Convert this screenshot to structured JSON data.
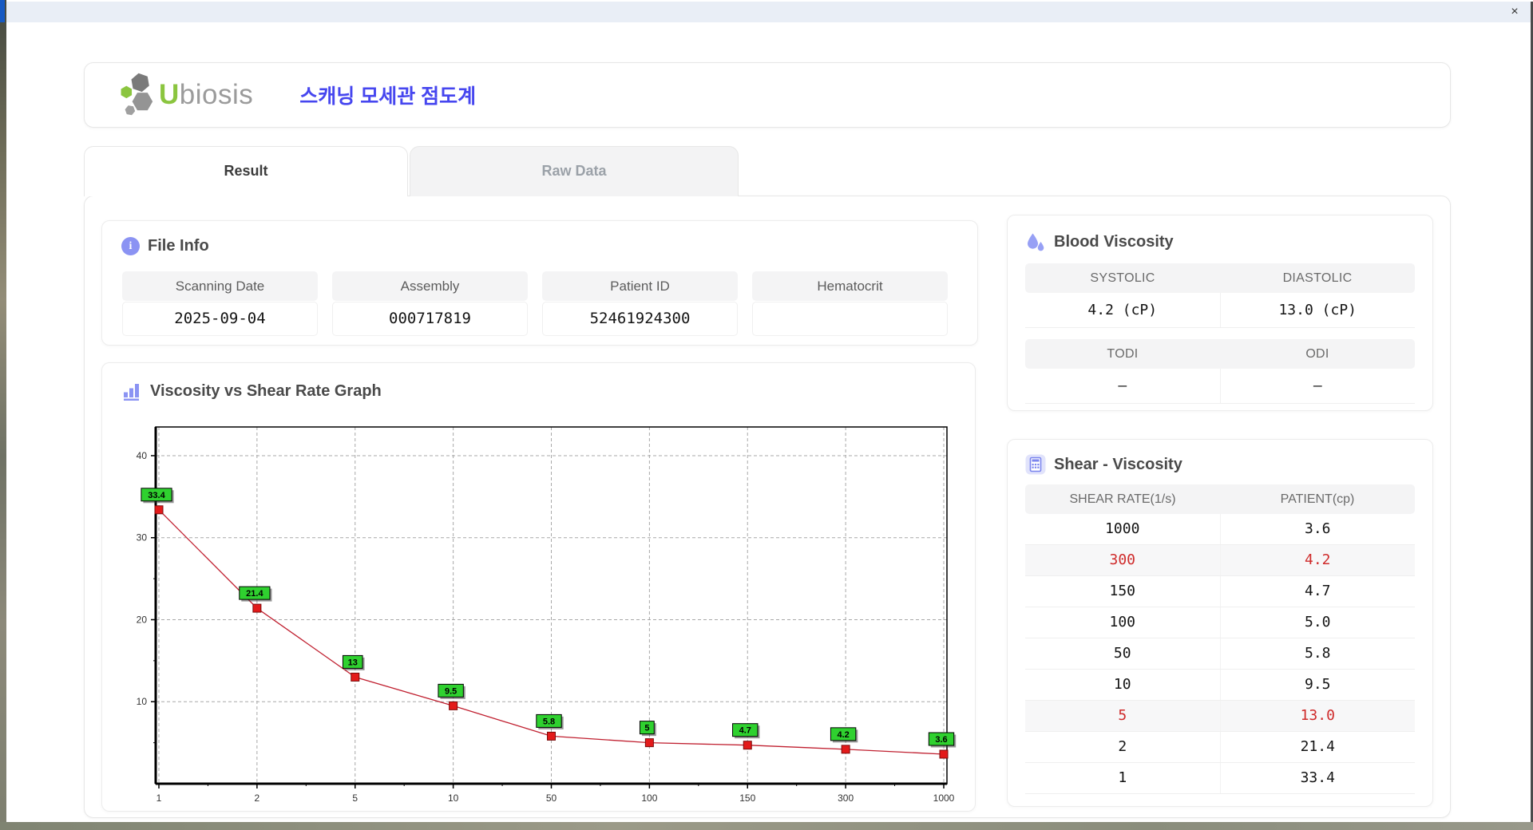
{
  "window": {
    "close_label": "×"
  },
  "header": {
    "brand_u": "U",
    "brand_rest": "biosis",
    "app_title": "스캐닝 모세관 점도계"
  },
  "tabs": [
    {
      "label": "Result",
      "active": true
    },
    {
      "label": "Raw Data",
      "active": false
    }
  ],
  "file_info": {
    "title": "File Info",
    "fields": [
      {
        "label": "Scanning Date",
        "value": "2025-09-04"
      },
      {
        "label": "Assembly",
        "value": "000717819"
      },
      {
        "label": "Patient ID",
        "value": "52461924300"
      },
      {
        "label": "Hematocrit",
        "value": ""
      }
    ]
  },
  "blood_viscosity": {
    "title": "Blood Viscosity",
    "groups": [
      {
        "cells": [
          {
            "label": "SYSTOLIC",
            "value": "4.2 (cP)"
          },
          {
            "label": "DIASTOLIC",
            "value": "13.0 (cP)"
          }
        ]
      },
      {
        "cells": [
          {
            "label": "TODI",
            "value": "–"
          },
          {
            "label": "ODI",
            "value": "–"
          }
        ]
      }
    ]
  },
  "graph": {
    "title": "Viscosity vs Shear Rate Graph"
  },
  "chart_data": {
    "type": "line",
    "title": "Viscosity vs Shear Rate Graph",
    "x_categories": [
      1,
      2,
      5,
      10,
      50,
      100,
      150,
      300,
      1000
    ],
    "values": [
      33.4,
      21.4,
      13,
      9.5,
      5.8,
      5,
      4.7,
      4.2,
      3.6
    ],
    "point_labels": [
      "33.4",
      "21.4",
      "13",
      "9.5",
      "5.8",
      "5",
      "4.7",
      "4.2",
      "3.6"
    ],
    "yticks": [
      10,
      20,
      30,
      40
    ],
    "ylim": [
      0,
      43.5
    ],
    "xlabel": "",
    "ylabel": "",
    "grid": "dashed",
    "legend": "none",
    "line_color": "#c02030",
    "marker_color": "#e31a1a",
    "marker_border": "#7a0b0b",
    "label_bg": "#2fd12f"
  },
  "shear_viscosity": {
    "title": "Shear - Viscosity",
    "columns": [
      "SHEAR RATE(1/s)",
      "PATIENT(cp)"
    ],
    "rows": [
      {
        "shear_rate": "1000",
        "patient": "3.6",
        "highlight": false
      },
      {
        "shear_rate": "300",
        "patient": "4.2",
        "highlight": true
      },
      {
        "shear_rate": "150",
        "patient": "4.7",
        "highlight": false
      },
      {
        "shear_rate": "100",
        "patient": "5.0",
        "highlight": false
      },
      {
        "shear_rate": "50",
        "patient": "5.8",
        "highlight": false
      },
      {
        "shear_rate": "10",
        "patient": "9.5",
        "highlight": false
      },
      {
        "shear_rate": "5",
        "patient": "13.0",
        "highlight": true
      },
      {
        "shear_rate": "2",
        "patient": "21.4",
        "highlight": false
      },
      {
        "shear_rate": "1",
        "patient": "33.4",
        "highlight": false
      }
    ]
  },
  "colors": {
    "accent_purple": "#8b93f3",
    "title_blue": "#4646ef",
    "brand_green": "#8bc53f",
    "highlight_red": "#cf2b2b",
    "titlebar": "#e9eef6"
  }
}
